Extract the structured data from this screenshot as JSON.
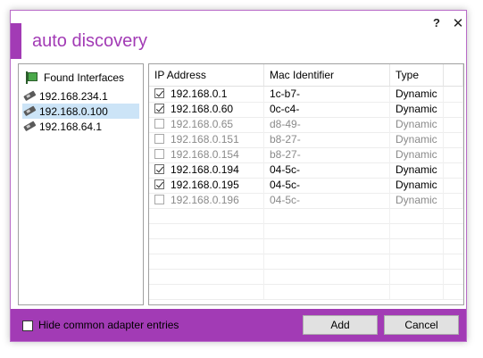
{
  "window": {
    "title": "auto discovery",
    "help_glyph": "?",
    "close_glyph": "✕"
  },
  "interfaces": {
    "header_label": "Found Interfaces",
    "items": [
      {
        "label": "192.168.234.1",
        "selected": false
      },
      {
        "label": "192.168.0.100",
        "selected": true
      },
      {
        "label": "192.168.64.1",
        "selected": false
      }
    ]
  },
  "grid": {
    "columns": [
      "IP Address",
      "Mac Identifier",
      "Type"
    ],
    "rows": [
      {
        "ip": "192.168.0.1",
        "mac": "1c-b7-",
        "type": "Dynamic",
        "checked": true
      },
      {
        "ip": "192.168.0.60",
        "mac": "0c-c4-",
        "type": "Dynamic",
        "checked": true
      },
      {
        "ip": "192.168.0.65",
        "mac": "d8-49-",
        "type": "Dynamic",
        "checked": false
      },
      {
        "ip": "192.168.0.151",
        "mac": "b8-27-",
        "type": "Dynamic",
        "checked": false
      },
      {
        "ip": "192.168.0.154",
        "mac": "b8-27-",
        "type": "Dynamic",
        "checked": false
      },
      {
        "ip": "192.168.0.194",
        "mac": "04-5c-",
        "type": "Dynamic",
        "checked": true
      },
      {
        "ip": "192.168.0.195",
        "mac": "04-5c-",
        "type": "Dynamic",
        "checked": true
      },
      {
        "ip": "192.168.0.196",
        "mac": "04-5c-",
        "type": "Dynamic",
        "checked": false
      }
    ]
  },
  "footer": {
    "hide_common_label": "Hide common adapter entries",
    "hide_common_checked": false,
    "add_label": "Add",
    "cancel_label": "Cancel"
  },
  "colors": {
    "accent": "#a23bb5",
    "selection": "#cce4f7"
  },
  "icons": {
    "interfaces_header": "flag-icon",
    "interface_item": "network-card-icon"
  }
}
